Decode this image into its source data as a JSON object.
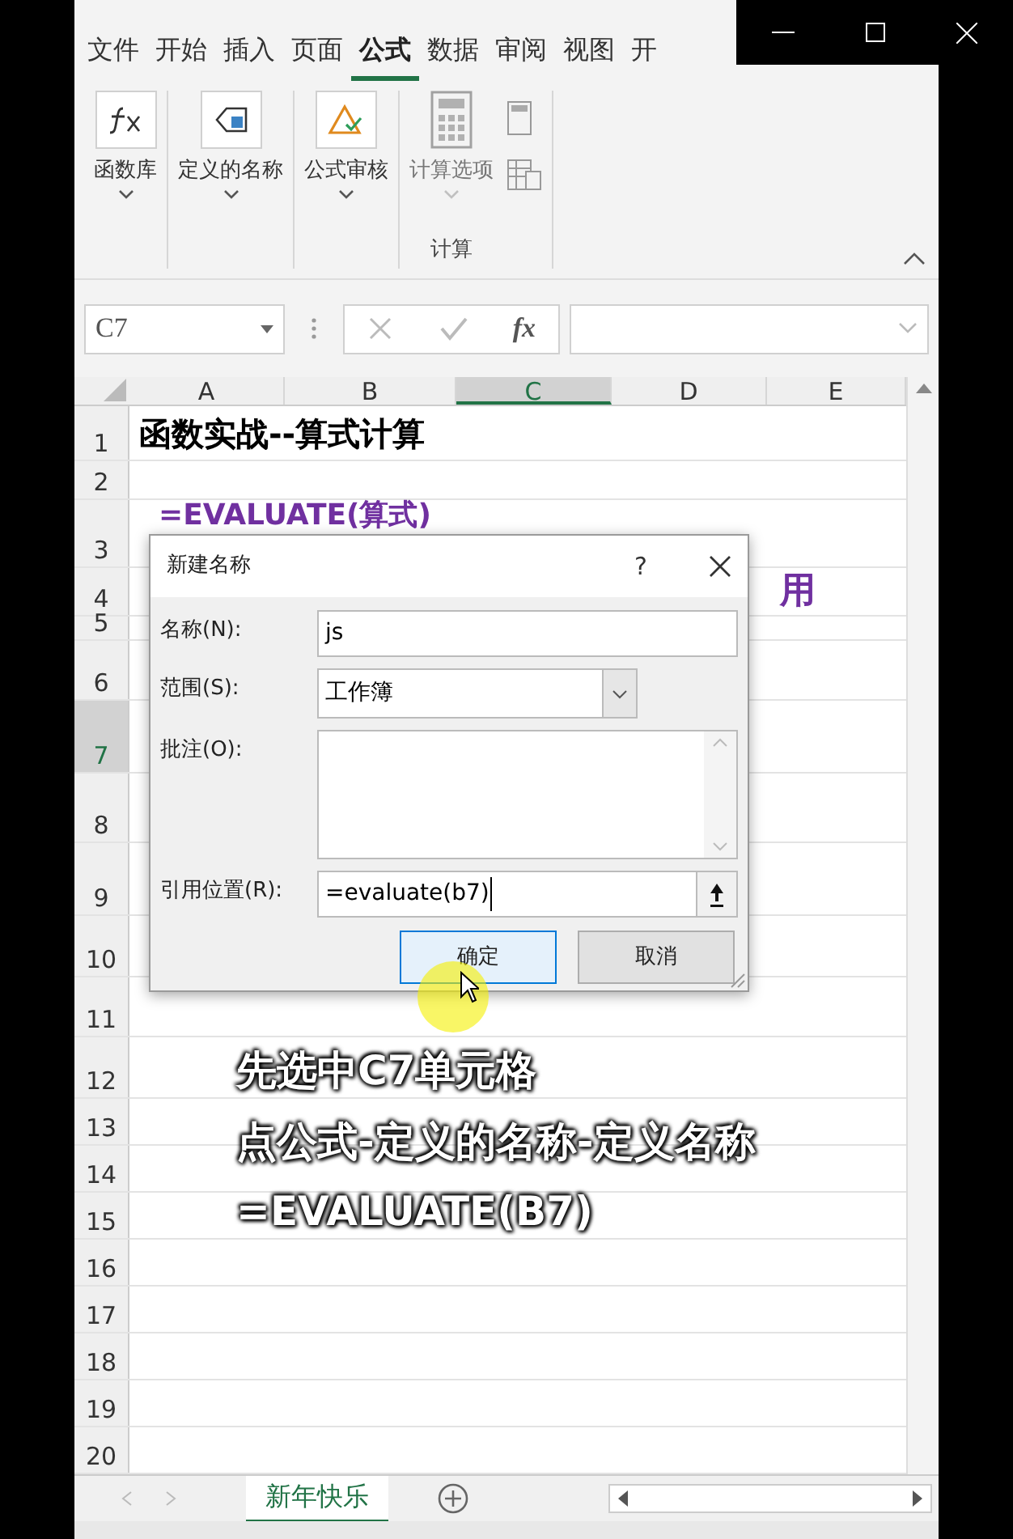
{
  "ribbon": {
    "tabs": [
      {
        "label": "文件",
        "selected": false
      },
      {
        "label": "开始",
        "selected": false
      },
      {
        "label": "插入",
        "selected": false
      },
      {
        "label": "页面",
        "selected": false
      },
      {
        "label": "公式",
        "selected": true
      },
      {
        "label": "数据",
        "selected": false
      },
      {
        "label": "审阅",
        "selected": false
      },
      {
        "label": "视图",
        "selected": false
      },
      {
        "label": "开",
        "selected": false
      }
    ],
    "groups": [
      {
        "kind": "function",
        "label": "函数库",
        "disabled": false
      },
      {
        "kind": "names",
        "label": "定义的名称",
        "disabled": false
      },
      {
        "kind": "audit",
        "label": "公式审核",
        "disabled": false
      },
      {
        "kind": "calc",
        "label": "计算选项",
        "disabled": true,
        "group_label": "计算"
      }
    ]
  },
  "formula_bar": {
    "name_box": "C7",
    "fx": "fx"
  },
  "columns": [
    {
      "label": "A",
      "selected": false
    },
    {
      "label": "B",
      "selected": false
    },
    {
      "label": "C",
      "selected": true
    },
    {
      "label": "D",
      "selected": false
    },
    {
      "label": "E",
      "selected": false
    }
  ],
  "rows": [
    {
      "n": "1",
      "selected": false,
      "text": "函数实战--算式计算",
      "kind": "title"
    },
    {
      "n": "2",
      "selected": false
    },
    {
      "n": "3",
      "selected": false,
      "text": "=EVALUATE(算式)",
      "kind": "formula"
    },
    {
      "n": "4",
      "selected": false,
      "text": "用",
      "kind": "tail"
    },
    {
      "n": "5",
      "selected": false
    },
    {
      "n": "6",
      "selected": false
    },
    {
      "n": "7",
      "selected": true
    },
    {
      "n": "8",
      "selected": false
    },
    {
      "n": "9",
      "selected": false
    },
    {
      "n": "10",
      "selected": false
    },
    {
      "n": "11",
      "selected": false
    },
    {
      "n": "12",
      "selected": false
    },
    {
      "n": "13",
      "selected": false
    },
    {
      "n": "14",
      "selected": false
    },
    {
      "n": "15",
      "selected": false
    },
    {
      "n": "16",
      "selected": false
    },
    {
      "n": "17",
      "selected": false
    },
    {
      "n": "18",
      "selected": false
    },
    {
      "n": "19",
      "selected": false
    },
    {
      "n": "20",
      "selected": false
    }
  ],
  "caption": [
    "先选中C7单元格",
    "点公式-定义的名称-定义名称",
    "=EVALUATE(B7)"
  ],
  "dialog": {
    "title": "新建名称",
    "help": "?",
    "fields": [
      {
        "kind": "text",
        "label": "名称(N):",
        "value": "js"
      },
      {
        "kind": "select",
        "label": "范围(S):",
        "value": "工作簿"
      },
      {
        "kind": "textarea",
        "label": "批注(O):"
      },
      {
        "kind": "ref",
        "label": "引用位置(R):",
        "value": "=evaluate(b7)"
      }
    ],
    "buttons": [
      {
        "label": "确定",
        "selected": true
      },
      {
        "label": "取消",
        "selected": false
      }
    ]
  },
  "sheet_tabs": [
    {
      "label": "新年快乐",
      "selected": true
    }
  ]
}
